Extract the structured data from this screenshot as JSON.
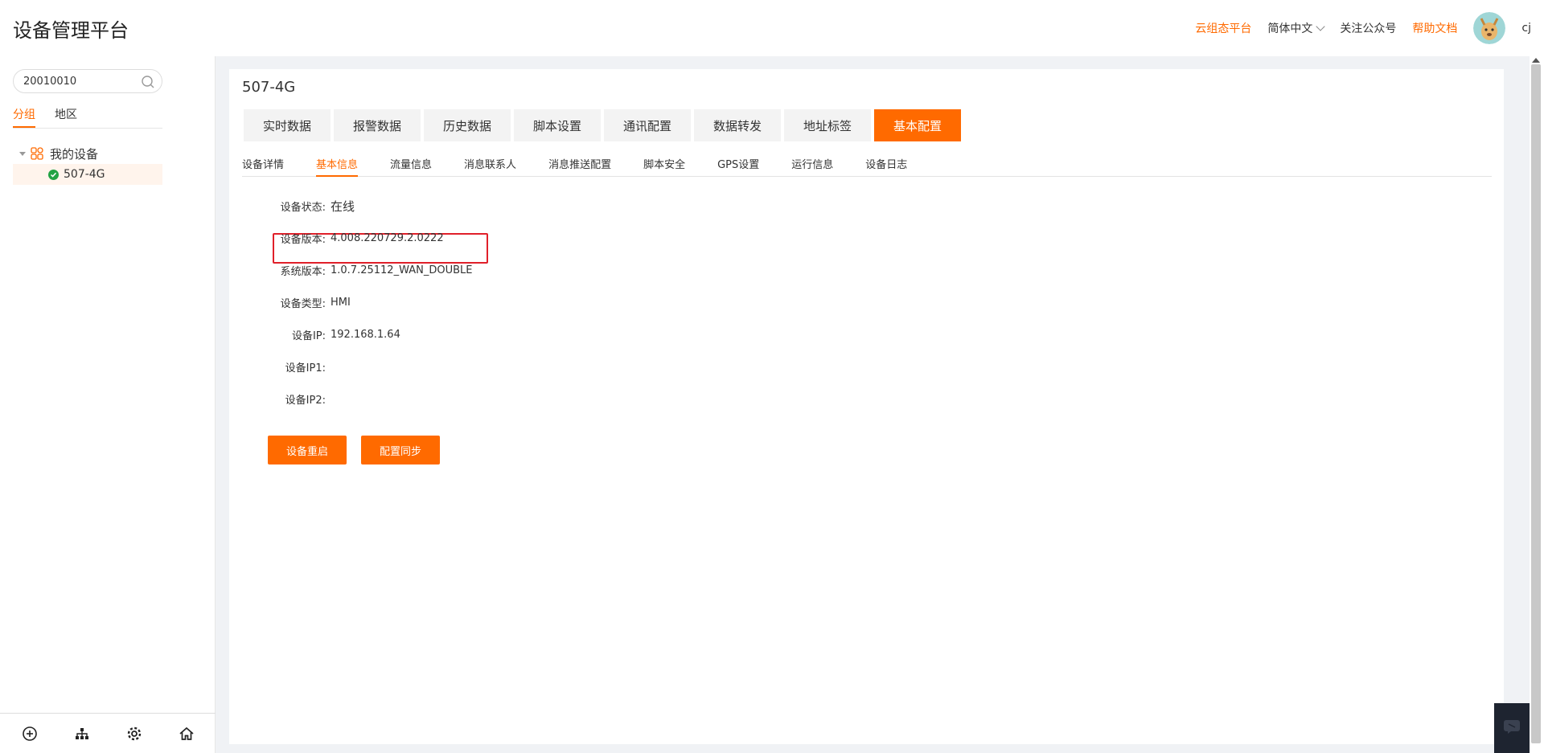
{
  "header": {
    "title": "设备管理平台",
    "links": {
      "cloud": "云组态平台",
      "language": "简体中文",
      "follow": "关注公众号",
      "help": "帮助文档"
    },
    "user": "cj"
  },
  "sidebar": {
    "search": {
      "value": "20010010"
    },
    "tabs": [
      "分组",
      "地区"
    ],
    "tree": {
      "group": "我的设备",
      "device": "507-4G"
    }
  },
  "main": {
    "device_name": "507-4G",
    "tabs": [
      "实时数据",
      "报警数据",
      "历史数据",
      "脚本设置",
      "通讯配置",
      "数据转发",
      "地址标签",
      "基本配置"
    ],
    "subtabs": [
      "设备详情",
      "基本信息",
      "流量信息",
      "消息联系人",
      "消息推送配置",
      "脚本安全",
      "GPS设置",
      "运行信息",
      "设备日志"
    ],
    "info": [
      {
        "label": "设备状态:",
        "value": "在线"
      },
      {
        "label": "设备版本:",
        "value": "4.008.220729.2.0222"
      },
      {
        "label": "系统版本:",
        "value": "1.0.7.25112_WAN_DOUBLE"
      },
      {
        "label": "设备类型:",
        "value": "HMI"
      },
      {
        "label": "设备IP:",
        "value": "192.168.1.64"
      },
      {
        "label": "设备IP1:",
        "value": ""
      },
      {
        "label": "设备IP2:",
        "value": ""
      }
    ],
    "buttons": {
      "restart": "设备重启",
      "sync": "配置同步"
    }
  },
  "colors": {
    "accent": "#ff6a00",
    "highlight": "#e0202a",
    "online": "#22a344"
  }
}
